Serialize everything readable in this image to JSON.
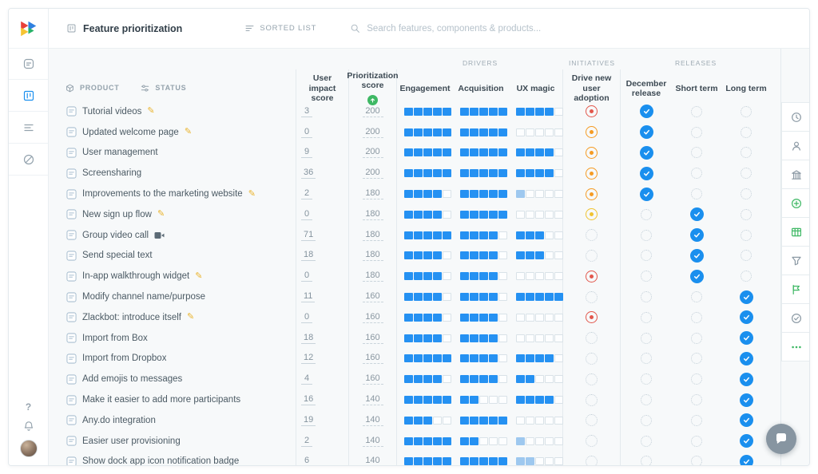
{
  "app": {
    "title": "Feature prioritization",
    "sorted_list": "SORTED LIST",
    "search_placeholder": "Search features, components & products..."
  },
  "toolbar": {
    "product": "PRODUCT",
    "status": "STATUS"
  },
  "columns": {
    "user_impact": "User impact score",
    "prioritization": "Prioritization score",
    "drivers_group": "DRIVERS",
    "initiatives_group": "INITIATIVES",
    "releases_group": "RELEASES",
    "engagement": "Engagement",
    "acquisition": "Acquisition",
    "ux_magic": "UX magic",
    "drive_adoption": "Drive new user adoption",
    "december": "December release",
    "short_term": "Short term",
    "long_term": "Long term"
  },
  "release_keys": [
    "december",
    "short",
    "long"
  ],
  "colors": {
    "accent_blue": "#1a8fee",
    "green": "#3eb864",
    "red": "#e2574c",
    "orange": "#f59b23",
    "yellow": "#f0c330"
  },
  "rows": [
    {
      "name": "Tutorial videos",
      "badge": "pencil",
      "impact": "3",
      "score": "200",
      "eng": 5,
      "acq": 5,
      "ux": 4,
      "drive": "red",
      "release": "december"
    },
    {
      "name": "Updated welcome page",
      "badge": "pencil",
      "impact": "0",
      "score": "200",
      "eng": 5,
      "acq": 5,
      "ux": 0,
      "drive": "orange",
      "release": "december"
    },
    {
      "name": "User management",
      "badge": null,
      "impact": "9",
      "score": "200",
      "eng": 5,
      "acq": 5,
      "ux": 4,
      "drive": "orange",
      "release": "december"
    },
    {
      "name": "Screensharing",
      "badge": null,
      "impact": "36",
      "score": "200",
      "eng": 5,
      "acq": 5,
      "ux": 4,
      "drive": "orange",
      "release": "december"
    },
    {
      "name": "Improvements to the marketing website",
      "badge": "pencil",
      "impact": "2",
      "score": "180",
      "eng": 4,
      "acq": 5,
      "ux": 1,
      "ux_light": true,
      "drive": "orange",
      "release": "december"
    },
    {
      "name": "New sign up flow",
      "badge": "pencil",
      "impact": "0",
      "score": "180",
      "eng": 4,
      "acq": 5,
      "ux": 0,
      "drive": "yellow",
      "release": "short"
    },
    {
      "name": "Group video call",
      "badge": "camera",
      "impact": "71",
      "score": "180",
      "eng": 5,
      "acq": 4,
      "ux": 3,
      "drive": "none",
      "release": "short"
    },
    {
      "name": "Send special text",
      "badge": null,
      "impact": "18",
      "score": "180",
      "eng": 4,
      "acq": 4,
      "ux": 3,
      "drive": "none",
      "release": "short"
    },
    {
      "name": "In-app walkthrough widget",
      "badge": "pencil",
      "impact": "0",
      "score": "180",
      "eng": 4,
      "acq": 4,
      "ux": 0,
      "drive": "red",
      "release": "short"
    },
    {
      "name": "Modify channel name/purpose",
      "badge": null,
      "impact": "11",
      "score": "160",
      "eng": 4,
      "acq": 4,
      "ux": 5,
      "drive": "none",
      "release": "long"
    },
    {
      "name": "Zlackbot: introduce itself",
      "badge": "pencil",
      "impact": "0",
      "score": "160",
      "eng": 4,
      "acq": 4,
      "ux": 0,
      "drive": "red",
      "release": "long"
    },
    {
      "name": "Import from Box",
      "badge": null,
      "impact": "18",
      "score": "160",
      "eng": 4,
      "acq": 4,
      "ux": 0,
      "drive": "none",
      "release": "long"
    },
    {
      "name": "Import from Dropbox",
      "badge": null,
      "impact": "12",
      "score": "160",
      "eng": 5,
      "acq": 4,
      "ux": 4,
      "drive": "none",
      "release": "long"
    },
    {
      "name": "Add emojis to messages",
      "badge": null,
      "impact": "4",
      "score": "160",
      "eng": 4,
      "acq": 4,
      "ux": 2,
      "drive": "none",
      "release": "long"
    },
    {
      "name": "Make it easier to add more participants",
      "badge": null,
      "impact": "16",
      "score": "140",
      "eng": 5,
      "acq": 2,
      "ux": 4,
      "drive": "none",
      "release": "long"
    },
    {
      "name": "Any.do integration",
      "badge": null,
      "impact": "19",
      "score": "140",
      "eng": 3,
      "acq": 5,
      "ux": 0,
      "drive": "none",
      "release": "long"
    },
    {
      "name": "Easier user provisioning",
      "badge": null,
      "impact": "2",
      "score": "140",
      "eng": 5,
      "acq": 2,
      "ux": 1,
      "ux_light": true,
      "drive": "none",
      "release": "long"
    },
    {
      "name": "Show dock app icon notification badge",
      "badge": null,
      "impact": "6",
      "score": "140",
      "eng": 5,
      "acq": 5,
      "ux": 2,
      "ux_light": true,
      "drive": "none",
      "release": "long"
    }
  ],
  "left_rail": {
    "items": [
      {
        "icon": "notes-icon"
      },
      {
        "icon": "board-icon",
        "active": true
      },
      {
        "icon": "list-icon"
      },
      {
        "icon": "disabled-icon"
      }
    ],
    "bottom": [
      "help-icon",
      "bell-icon",
      "avatar"
    ]
  },
  "right_rail": {
    "items": [
      {
        "icon": "history-icon"
      },
      {
        "icon": "user-icon"
      },
      {
        "icon": "columns-icon"
      },
      {
        "icon": "add-circle-icon",
        "green": true
      },
      {
        "icon": "table-icon",
        "green": true
      },
      {
        "icon": "funnel-icon"
      },
      {
        "icon": "flag-icon",
        "green": true
      },
      {
        "icon": "check-circle-icon"
      },
      {
        "icon": "more-icon",
        "green": true
      }
    ]
  }
}
